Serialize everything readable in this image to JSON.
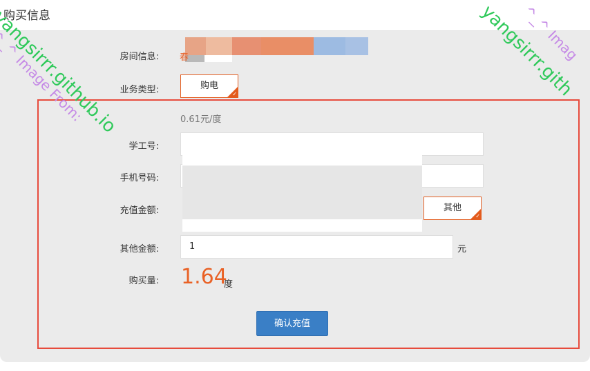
{
  "header": {
    "title": "购买信息"
  },
  "form": {
    "room_label": "房间信息:",
    "room_value_visible": "春",
    "service_label": "业务类型:",
    "service_selected": "购电",
    "price": "0.61元/度",
    "student_id_label": "学工号:",
    "student_id_value": "",
    "phone_label": "手机号码:",
    "phone_value": "",
    "amount_label": "充值金额:",
    "amount_other_option": "其他",
    "other_amount_label": "其他金额:",
    "other_amount_value": "1",
    "other_amount_unit": "元",
    "quantity_label": "购买量:",
    "quantity_value": "1.64",
    "quantity_unit": "度",
    "confirm_label": "确认充值"
  },
  "watermark": {
    "line1": "^_^ Image From:",
    "line2": "yangsirrr.github.io",
    "line3": "^_^ Imag",
    "line4": "yangsirrr.gith"
  },
  "colors": {
    "accent_orange": "#e35b1d",
    "highlight_red": "#e74b3c",
    "button_blue": "#3a7fc6"
  }
}
